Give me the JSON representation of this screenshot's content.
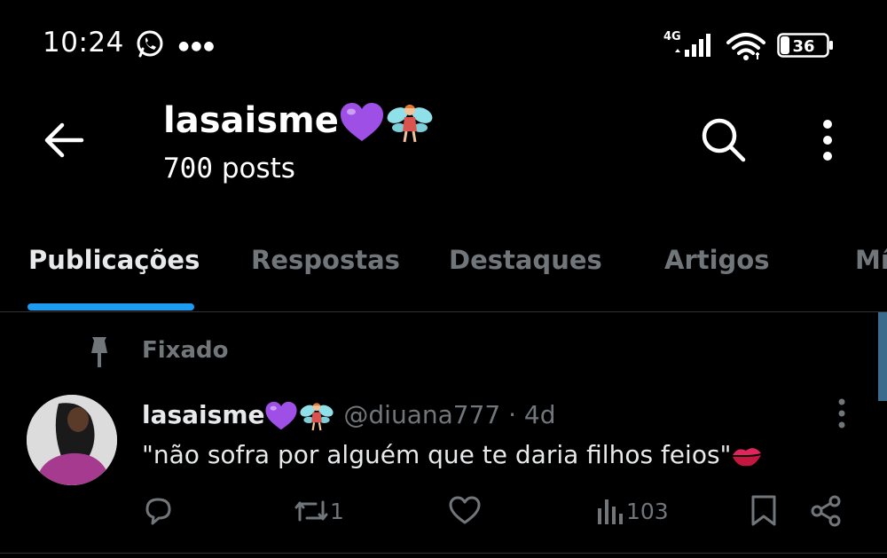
{
  "status_bar": {
    "time": "10:24",
    "network": "4G",
    "battery": "36",
    "icons": [
      "whatsapp-icon",
      "more-notifications-icon",
      "signal-icon",
      "wifi-icon",
      "battery-icon"
    ]
  },
  "header": {
    "name": "lasaisme",
    "name_emojis": [
      "purple-heart",
      "fairy"
    ],
    "post_count_number": "700",
    "post_count_suffix": " posts",
    "icons": [
      "back-arrow-icon",
      "search-icon",
      "overflow-menu-icon"
    ]
  },
  "tabs": [
    {
      "label": "Publicações",
      "active": true
    },
    {
      "label": "Respostas",
      "active": false
    },
    {
      "label": "Destaques",
      "active": false
    },
    {
      "label": "Artigos",
      "active": false
    },
    {
      "label": "Mí",
      "active": false
    }
  ],
  "pinned": {
    "label": "Fixado",
    "icon": "pin-icon"
  },
  "tweet": {
    "author_name": "lasaisme",
    "handle": "@diuana777",
    "separator": "·",
    "time": "4d",
    "text": "\"não sofra por alguém que te daria filhos feios\"",
    "text_emoji": "kiss-mark",
    "actions": {
      "reply_count": "",
      "retweet_count": "1",
      "like_count": "",
      "views_count": "103"
    }
  },
  "colors": {
    "background": "#000000",
    "text_primary": "#e7e9ea",
    "text_secondary": "#71767b",
    "accent": "#1d9bf0",
    "divider": "#2f3336"
  }
}
